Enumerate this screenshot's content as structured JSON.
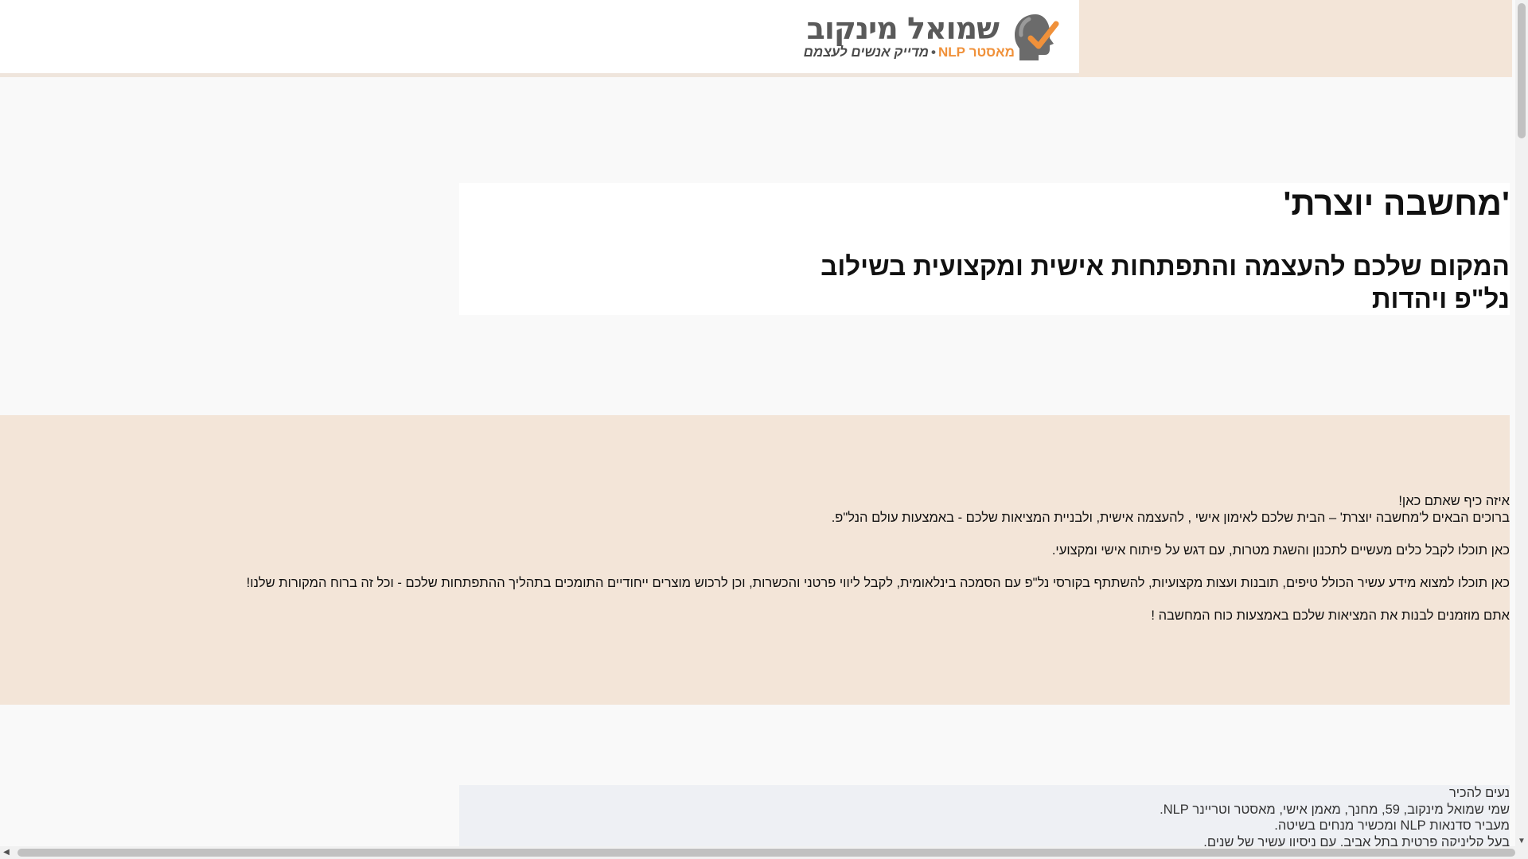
{
  "header": {
    "logo": {
      "title": "שמואל מינקוב",
      "subtitle_orange": "מאסטר NLP",
      "separator": "•",
      "subtitle_gray": "מדייק אנשים לעצמם",
      "icon": "head-checkmark-icon",
      "colors": {
        "accent": "#f0913a",
        "gray": "#5a5a5a"
      }
    }
  },
  "hero": {
    "title": "'מחשבה יוצרת'",
    "subtitle": "המקום שלכם להעצמה והתפתחות אישית ומקצועית בשילוב נל\"פ ויהדות"
  },
  "welcome": {
    "line1": "איזה כיף שאתם כאן!",
    "line2": "ברוכים הבאים ל'מחשבה יוצרת' – הבית שלכם לאימון אישי , להעצמה אישית, ולבניית המציאות שלכם - באמצעות עולם הנל\"פ.",
    "line3": "כאן תוכלו לקבל כלים מעשיים לתכנון והשגת מטרות, עם דגש על פיתוח אישי ומקצועי.",
    "line4": "כאן תוכלו למצוא מידע עשיר הכולל טיפים, תובנות ועצות מקצועיות, להשתתף בקורסי נל\"פ עם הסמכה בינלאומית, לקבל ליווי פרטני והכשרות, וכן לרכוש מוצרים ייחודיים התומכים בתהליך ההתפתחות שלכם - וכל זה ברוח המקורות שלנו!",
    "line5": "אתם מוזמנים לבנות את המציאות שלכם באמצעות כוח המחשבה !"
  },
  "about": {
    "line1": "נעים להכיר",
    "line2": "שמי שמואל מינקוב, 59, מחנך, מאמן אישי, מאסטר וטריינר NLP.",
    "line3": "מעביר סדנאות NLP ומכשיר מנחים בשיטה.",
    "line4": "בעל קליניקה פרטית בתל אביב. עם ניסיון עשיר של שנים."
  },
  "scrollbars": {
    "down_arrow": "▼",
    "left_arrow": "◀"
  }
}
